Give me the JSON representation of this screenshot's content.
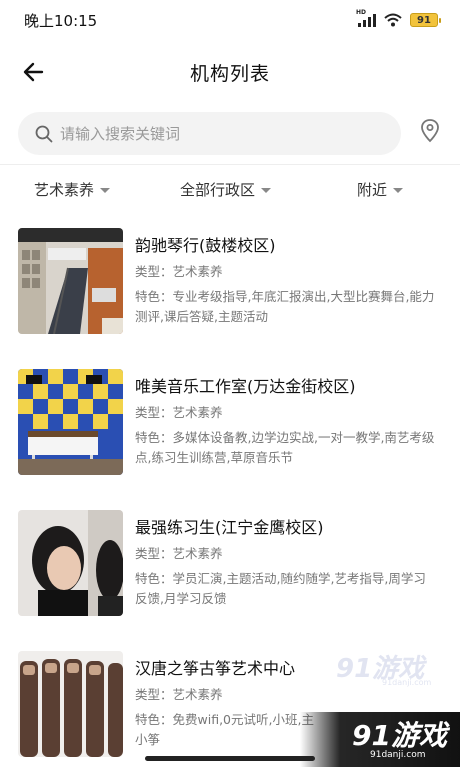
{
  "status_bar": {
    "time": "晚上10:15",
    "network": "HD",
    "battery": "91"
  },
  "header": {
    "title": "机构列表"
  },
  "search": {
    "placeholder": "请输入搜索关键词",
    "value": ""
  },
  "filters": [
    {
      "label": "艺术素养"
    },
    {
      "label": "全部行政区"
    },
    {
      "label": "附近"
    }
  ],
  "items": [
    {
      "name": "韵驰琴行(鼓楼校区)",
      "type": "类型：艺术素养",
      "features": "特色：专业考级指导,年底汇报演出,大型比赛舞台,能力测评,课后答疑,主题活动"
    },
    {
      "name": "唯美音乐工作室(万达金街校区)",
      "type": "类型：艺术素养",
      "features": "特色：多媒体设备教,边学边实战,一对一教学,南艺考级点,练习生训练营,草原音乐节"
    },
    {
      "name": "最强练习生(江宁金鹰校区)",
      "type": "类型：艺术素养",
      "features": "特色：学员汇演,主题活动,随约随学,艺考指导,周学习反馈,月学习反馈"
    },
    {
      "name": "汉唐之筝古筝艺术中心",
      "type": "类型：艺术素养",
      "features": "特色：免费wifi,0元试听,小班,主",
      "features_line2": "小筝"
    }
  ],
  "watermark": {
    "small": "91游戏",
    "small_sub": "91danji.com",
    "big": "91游戏",
    "big_sub": "91danji.com"
  },
  "colors": {
    "accent_gray": "#777777",
    "search_bg": "#f3f3f3",
    "battery": "#f2c33c"
  }
}
